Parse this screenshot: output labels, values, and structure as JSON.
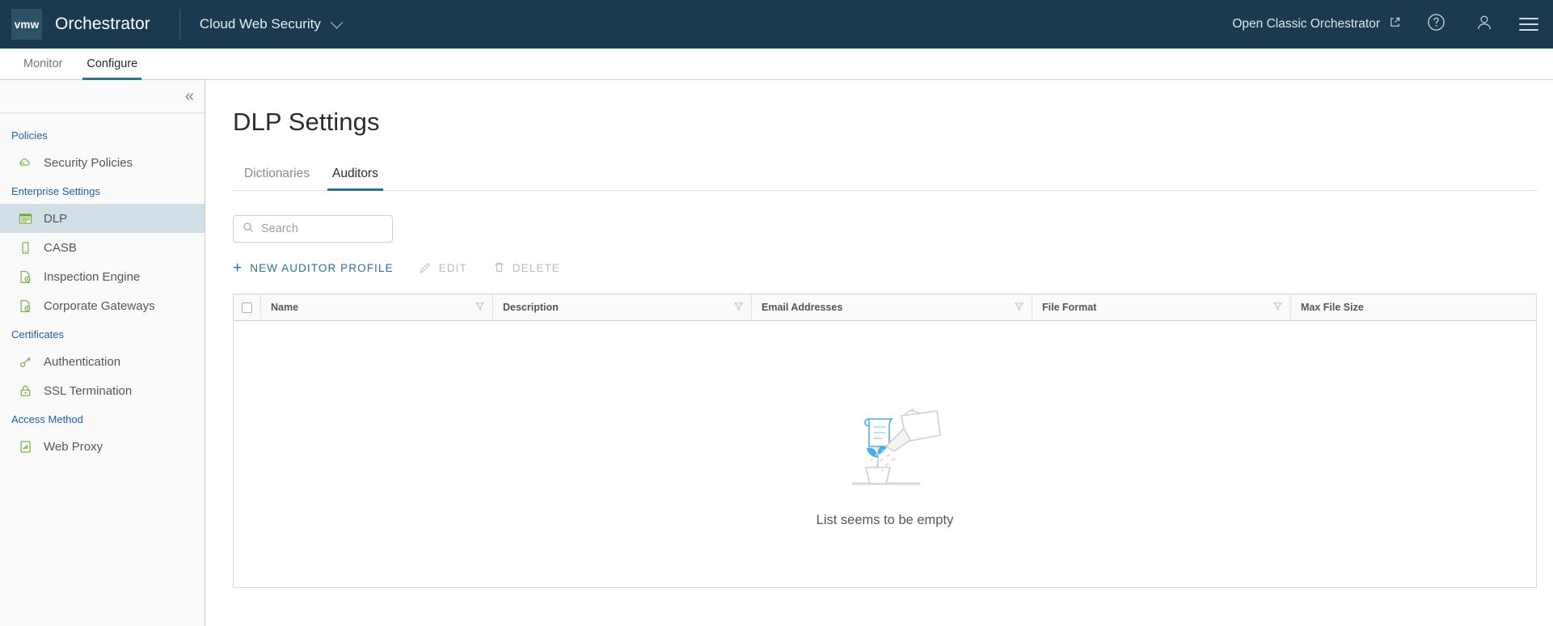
{
  "header": {
    "logo_text": "vmw",
    "product": "Orchestrator",
    "service_selector": "Cloud Web Security",
    "open_classic": "Open Classic Orchestrator",
    "icons": {
      "external_link": "external-link-icon",
      "help": "help-icon",
      "user": "user-icon",
      "menu": "hamburger-menu-icon",
      "chevron": "chevron-down-icon"
    }
  },
  "subnav": {
    "tabs": [
      {
        "label": "Monitor",
        "active": false
      },
      {
        "label": "Configure",
        "active": true
      }
    ]
  },
  "sidebar": {
    "collapse_icon": "double-chevron-left-icon",
    "groups": [
      {
        "label": "Policies",
        "items": [
          {
            "label": "Security Policies",
            "icon": "cloud-policy-icon",
            "selected": false
          }
        ]
      },
      {
        "label": "Enterprise Settings",
        "items": [
          {
            "label": "DLP",
            "icon": "table-grid-icon",
            "selected": true
          },
          {
            "label": "CASB",
            "icon": "mobile-device-icon",
            "selected": false
          },
          {
            "label": "Inspection Engine",
            "icon": "document-gear-icon",
            "selected": false
          },
          {
            "label": "Corporate Gateways",
            "icon": "document-gear-icon",
            "selected": false
          }
        ]
      },
      {
        "label": "Certificates",
        "items": [
          {
            "label": "Authentication",
            "icon": "key-icon",
            "selected": false
          },
          {
            "label": "SSL Termination",
            "icon": "lock-icon",
            "selected": false
          }
        ]
      },
      {
        "label": "Access Method",
        "items": [
          {
            "label": "Web Proxy",
            "icon": "share-document-icon",
            "selected": false
          }
        ]
      }
    ]
  },
  "main": {
    "title": "DLP Settings",
    "tabs": [
      {
        "label": "Dictionaries",
        "active": false
      },
      {
        "label": "Auditors",
        "active": true
      }
    ],
    "search": {
      "placeholder": "Search",
      "value": "",
      "icon": "search-icon"
    },
    "actions": [
      {
        "label": "New Auditor Profile",
        "icon": "plus-icon",
        "disabled": false
      },
      {
        "label": "Edit",
        "icon": "pencil-icon",
        "disabled": true
      },
      {
        "label": "Delete",
        "icon": "trash-icon",
        "disabled": true
      }
    ],
    "table": {
      "select_all_checkbox": "unchecked",
      "columns": [
        {
          "label": "Name",
          "filterable": true
        },
        {
          "label": "Description",
          "filterable": true
        },
        {
          "label": "Email Addresses",
          "filterable": true
        },
        {
          "label": "File Format",
          "filterable": true
        },
        {
          "label": "Max File Size",
          "filterable": false
        }
      ],
      "rows": [],
      "empty_state": {
        "message": "List seems to be empty",
        "illustration": "watering-can-plant-document-icon"
      }
    }
  },
  "colors": {
    "header_bg": "#1b3a4f",
    "accent_blue": "#2e6f94",
    "link_blue": "#1f5fa9",
    "nav_icon_green": "#73a93e",
    "selected_row": "#d2dee5",
    "illustration_blue": "#49afe0"
  }
}
